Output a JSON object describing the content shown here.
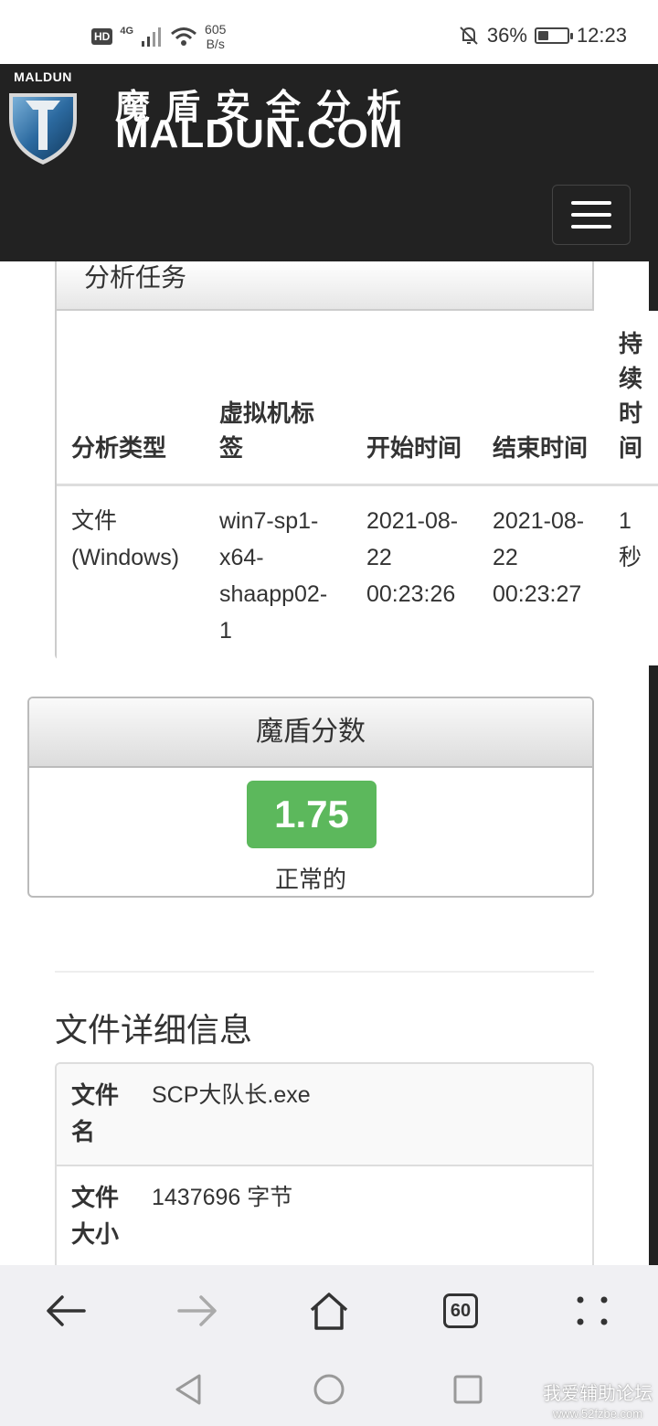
{
  "status_bar": {
    "hd": "HD",
    "network": "4G",
    "speed_value": "605",
    "speed_unit": "B/s",
    "battery": "36%",
    "battery_level": 0.36,
    "time": "12:23"
  },
  "header": {
    "logo_text": "MALDUN",
    "brand_cn": "魔盾安全分析",
    "brand_en": "MALDUN.COM"
  },
  "task_panel": {
    "title": "分析任务",
    "columns": [
      "分析类型",
      "虚拟机标签",
      "开始时间",
      "结束时间",
      "持续时间"
    ],
    "row": [
      "文件 (Windows)",
      "win7-sp1-x64-shaapp02-1",
      "2021-08-22 00:23:26",
      "2021-08-22 00:23:27",
      "1 秒"
    ]
  },
  "score_panel": {
    "title": "魔盾分数",
    "score": "1.75",
    "status": "正常的"
  },
  "file_details": {
    "title": "文件详细信息",
    "rows": [
      {
        "key": "文件名",
        "value": "SCP大队长.exe"
      },
      {
        "key": "文件大小",
        "value": "1437696 字节"
      }
    ]
  },
  "browser_bar": {
    "tab_count": "60"
  },
  "watermark": {
    "line1": "我爱辅助论坛",
    "line2": "www.52fzbe.com"
  }
}
